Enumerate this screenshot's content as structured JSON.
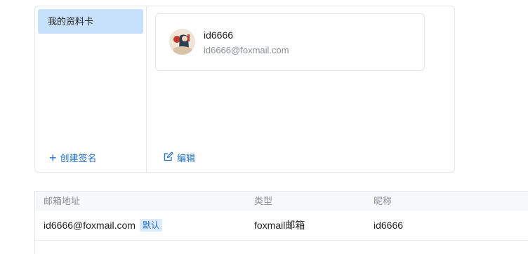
{
  "sidebar": {
    "items": [
      {
        "label": "我的资料卡"
      }
    ],
    "create_signature_label": "创建签名"
  },
  "profile": {
    "name": "id6666",
    "email": "id6666@foxmail.com"
  },
  "edit_label": "编辑",
  "table": {
    "headers": [
      "邮箱地址",
      "类型",
      "昵称"
    ],
    "rows": [
      {
        "email": "id6666@foxmail.com",
        "badge": "默认",
        "type": "foxmail邮箱",
        "nickname": "id6666"
      }
    ]
  },
  "colors": {
    "accent": "#1f6fc8",
    "selected_bg": "#c7e0fb"
  }
}
